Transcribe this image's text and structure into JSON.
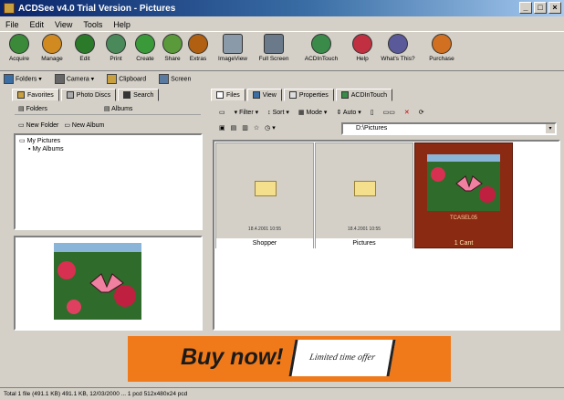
{
  "window": {
    "title": "ACDSee v4.0 Trial Version - Pictures",
    "buttons": [
      "_",
      "□",
      "×"
    ]
  },
  "menu": [
    "File",
    "Edit",
    "View",
    "Tools",
    "Help"
  ],
  "toolbar": [
    {
      "label": "Acquire",
      "icon": "acquire-icon",
      "color": "#3a8a3a"
    },
    {
      "label": "Manage",
      "icon": "manage-icon",
      "color": "#d08a20"
    },
    {
      "label": "Edit",
      "icon": "edit-icon",
      "color": "#2a7a2a"
    },
    {
      "label": "Print",
      "icon": "print-icon",
      "color": "#4a8a5a"
    },
    {
      "label": "Create",
      "icon": "create-icon",
      "color": "#3a9a3a"
    },
    {
      "label": "Share",
      "icon": "share-icon",
      "color": "#5a9a3a"
    },
    {
      "label": "Extras",
      "icon": "extras-icon",
      "color": "#b06010"
    },
    {
      "label": "ImageView",
      "icon": "image-view-icon",
      "color": "#8a9aa8"
    },
    {
      "label": "Full Screen",
      "icon": "full-screen-icon",
      "color": "#6a7a8a"
    },
    {
      "label": "ACDInTouch",
      "icon": "acd-intouch-icon",
      "color": "#3a8a4a"
    },
    {
      "label": "Help",
      "icon": "help-icon",
      "color": "#c03040"
    },
    {
      "label": "What's This?",
      "icon": "whats-this-icon",
      "color": "#5a5a9a"
    },
    {
      "label": "Purchase",
      "icon": "purchase-icon",
      "color": "#d07020"
    }
  ],
  "subtoolbar": [
    {
      "label": "Folders",
      "icon": "folders-icon"
    },
    {
      "label": "Camera",
      "icon": "camera-icon"
    },
    {
      "label": "Clipboard",
      "icon": "clipboard-icon"
    },
    {
      "label": "Screen",
      "icon": "screen-icon"
    }
  ],
  "left_tabs": [
    "Favorites",
    "Photo Discs",
    "Search"
  ],
  "left_row1": [
    "Folders",
    "Albums"
  ],
  "left_row2": [
    "New Folder",
    "New Album"
  ],
  "tree": [
    "My Pictures",
    "My Albums"
  ],
  "right_tabs": [
    "Files",
    "View",
    "Properties",
    "ACDInTouch"
  ],
  "filter_bar": {
    "filter": "Filter",
    "sort": "Sort",
    "mode": "Mode",
    "size": "Auto"
  },
  "path": "D:\\Pictures",
  "thumbs": [
    {
      "caption": "Shopper",
      "meta": "18.4.2001 10:55",
      "selected": false
    },
    {
      "caption": "Pictures",
      "meta": "18.4.2001 10:55",
      "selected": false
    },
    {
      "caption": "1 Cant",
      "meta": "TCASEL05",
      "selected": true
    }
  ],
  "banner": {
    "buy": "Buy now!",
    "offer": "Limited time offer"
  },
  "status": "Total 1 file (491.1 KB) 491.1 KB, 12/03/2000 ... 1 pcd 512x480x24 pcd",
  "colors": {
    "selected": "#8b2a12",
    "banner": "#f07a1a",
    "title_start": "#0a246a"
  }
}
